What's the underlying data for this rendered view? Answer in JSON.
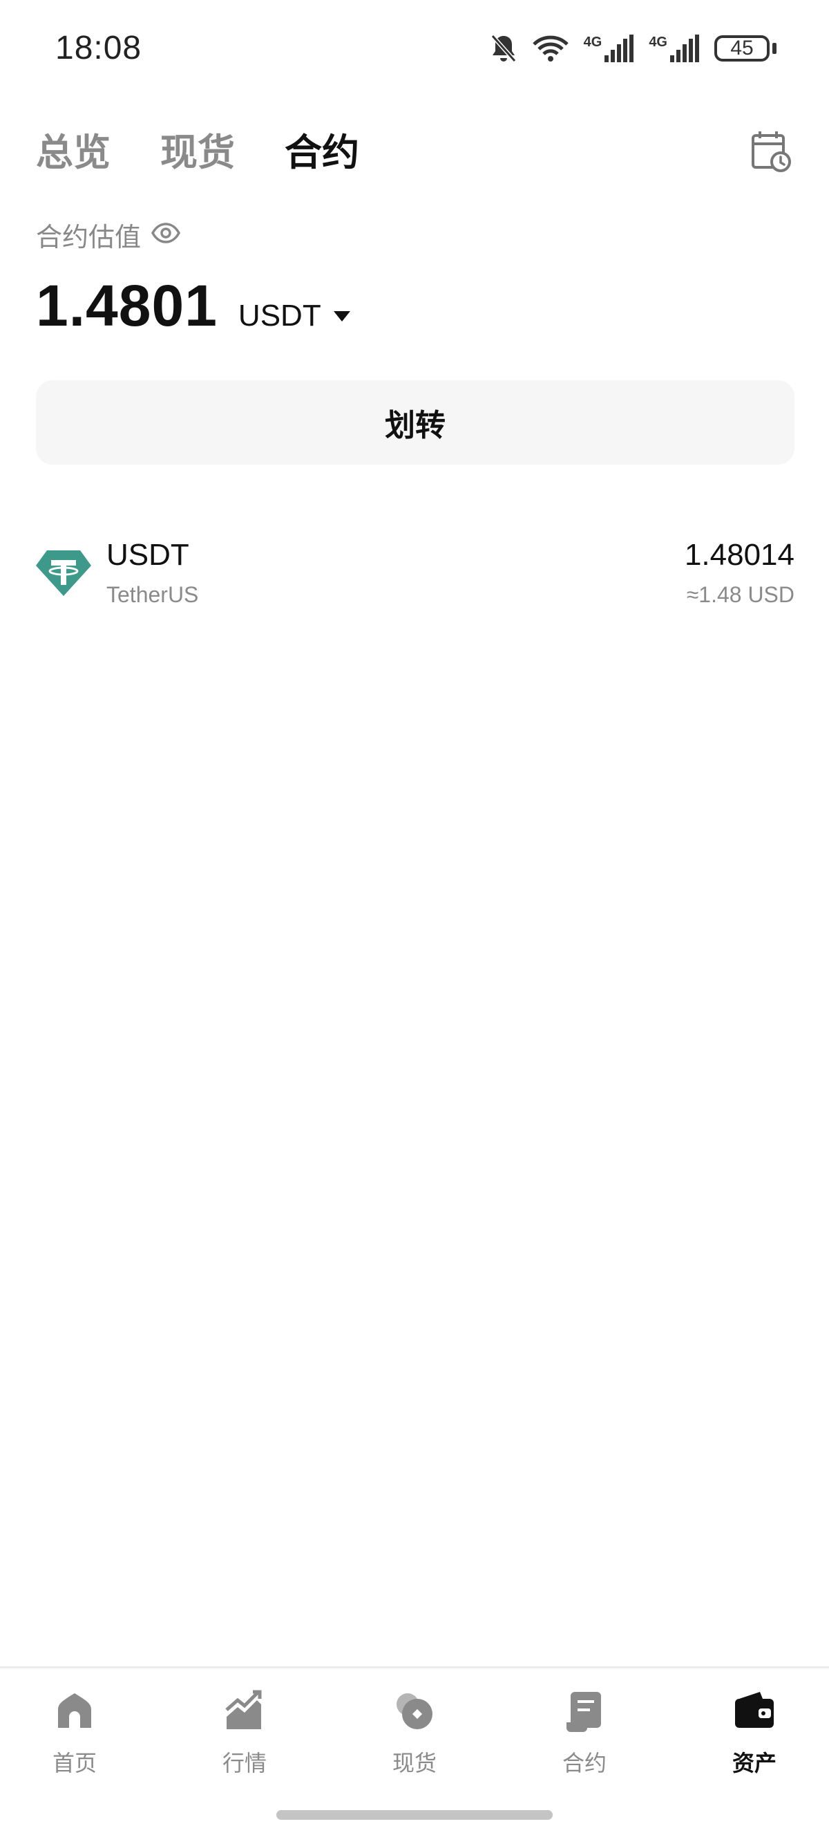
{
  "status_bar": {
    "time": "18:08",
    "network_1": "4G",
    "network_2": "4G",
    "battery": "45"
  },
  "tabs": [
    {
      "label": "总览",
      "active": false
    },
    {
      "label": "现货",
      "active": false
    },
    {
      "label": "合约",
      "active": true
    }
  ],
  "valuation": {
    "label": "合约估值",
    "value": "1.4801",
    "currency": "USDT"
  },
  "transfer_label": "划转",
  "assets": [
    {
      "symbol": "USDT",
      "name": "TetherUS",
      "amount": "1.48014",
      "usd_value": "≈1.48 USD",
      "logo_color": "#3d9a8b"
    }
  ],
  "bottom_nav": [
    {
      "label": "首页",
      "icon": "home-icon",
      "active": false
    },
    {
      "label": "行情",
      "icon": "market-chart-icon",
      "active": false
    },
    {
      "label": "现货",
      "icon": "spot-coins-icon",
      "active": false
    },
    {
      "label": "合约",
      "icon": "contract-document-icon",
      "active": false
    },
    {
      "label": "资产",
      "icon": "wallet-icon",
      "active": true
    }
  ],
  "colors": {
    "active_text": "#111111",
    "inactive_text": "#8a8a8a",
    "button_bg": "#f6f6f6",
    "tether_green": "#3d9a8b"
  }
}
